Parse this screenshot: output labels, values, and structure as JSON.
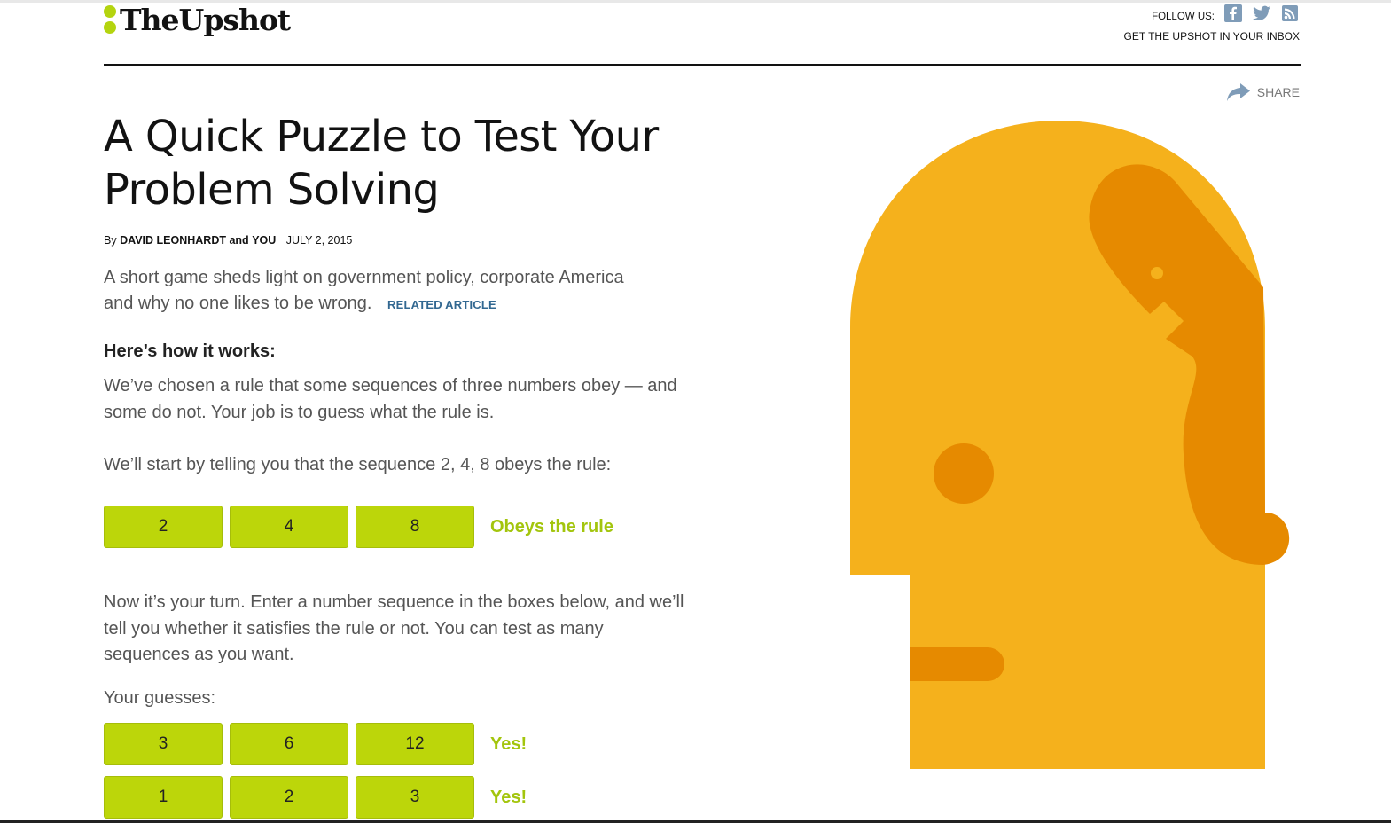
{
  "header": {
    "logo_text": "TheUpshot",
    "follow_label": "FOLLOW US:",
    "social_icons": [
      "facebook-icon",
      "twitter-icon",
      "rss-icon"
    ],
    "inbox_link": "GET THE UPSHOT IN YOUR INBOX"
  },
  "share": {
    "label": "SHARE",
    "icon": "share-arrow-icon"
  },
  "article": {
    "headline": "A Quick Puzzle to Test Your Problem Solving",
    "byline": {
      "by": "By",
      "author1": "DAVID LEONHARDT",
      "and": "and",
      "author2": "YOU",
      "date": "JULY 2, 2015"
    },
    "summary": "A short game sheds light on government policy, corporate America and why no one likes to be wrong.",
    "related_link": "RELATED ARTICLE",
    "subhead": "Here’s how it works:",
    "para1": "We’ve chosen a rule that some sequences of three numbers obey — and some do not. Your job is to guess what the rule is.",
    "para2": "We’ll start by telling you that the sequence 2, 4, 8 obeys the rule:",
    "para3": "Now it’s your turn. Enter a number sequence in the boxes below, and we’ll tell you whether it satisfies the rule or not. You can test as many sequences as you want.",
    "guesses_label": "Your guesses:"
  },
  "example": {
    "numbers": [
      "2",
      "4",
      "8"
    ],
    "result": "Obeys the rule"
  },
  "guesses": [
    {
      "numbers": [
        "3",
        "6",
        "12"
      ],
      "result": "Yes!"
    },
    {
      "numbers": [
        "1",
        "2",
        "3"
      ],
      "result": "Yes!"
    }
  ],
  "colors": {
    "accent_green": "#bcd60a",
    "result_green": "#a3c50d",
    "head_yellow": "#f5b11c",
    "head_orange": "#e68a00",
    "link_blue": "#326891"
  }
}
